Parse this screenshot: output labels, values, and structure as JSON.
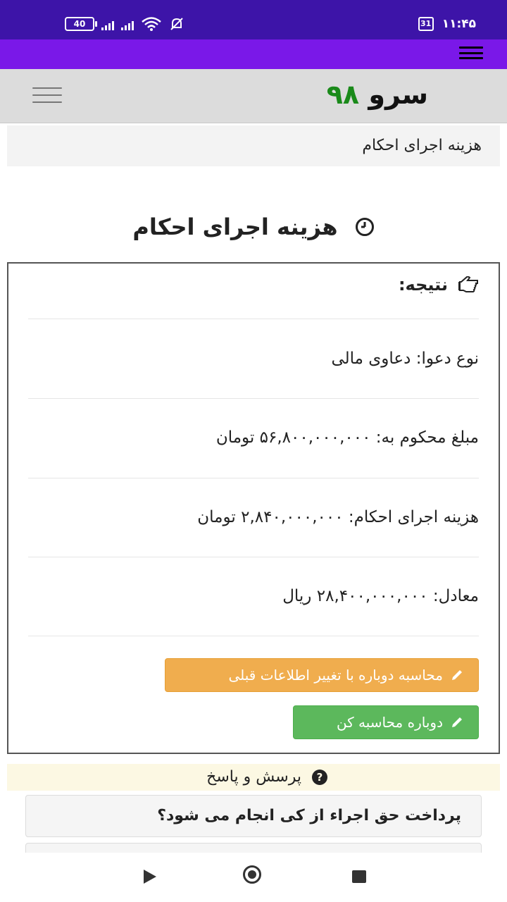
{
  "status_bar": {
    "battery": "40",
    "calendar": "31",
    "time": "۱۱:۴۵"
  },
  "header": {
    "logo_word": "سرو",
    "logo_number": "۹۸"
  },
  "breadcrumb": "هزینه اجرای احکام",
  "page_title": "هزینه اجرای احکام",
  "result": {
    "heading": "نتیجه:",
    "rows": [
      "نوع دعوا: دعاوی مالی",
      "مبلغ محکوم به: ۵۶,۸۰۰,۰۰۰,۰۰۰ تومان",
      "هزینه اجرای احکام: ۲,۸۴۰,۰۰۰,۰۰۰ تومان",
      "معادل: ۲۸,۴۰۰,۰۰۰,۰۰۰ ریال"
    ],
    "recalc_with_change_label": "محاسبه دوباره با تغییر اطلاعات قبلی",
    "recalc_label": "دوباره محاسبه کن"
  },
  "qa": {
    "title": "پرسش و پاسخ",
    "questions": [
      "پرداخت حق اجراء از کی انجام می شود؟"
    ]
  },
  "colors": {
    "status_bar": "#3d14a8",
    "purple_bar": "#7a18e8",
    "orange_button": "#f0ad4e",
    "green_button": "#5cb85c",
    "logo_green": "#1a8a1a"
  }
}
